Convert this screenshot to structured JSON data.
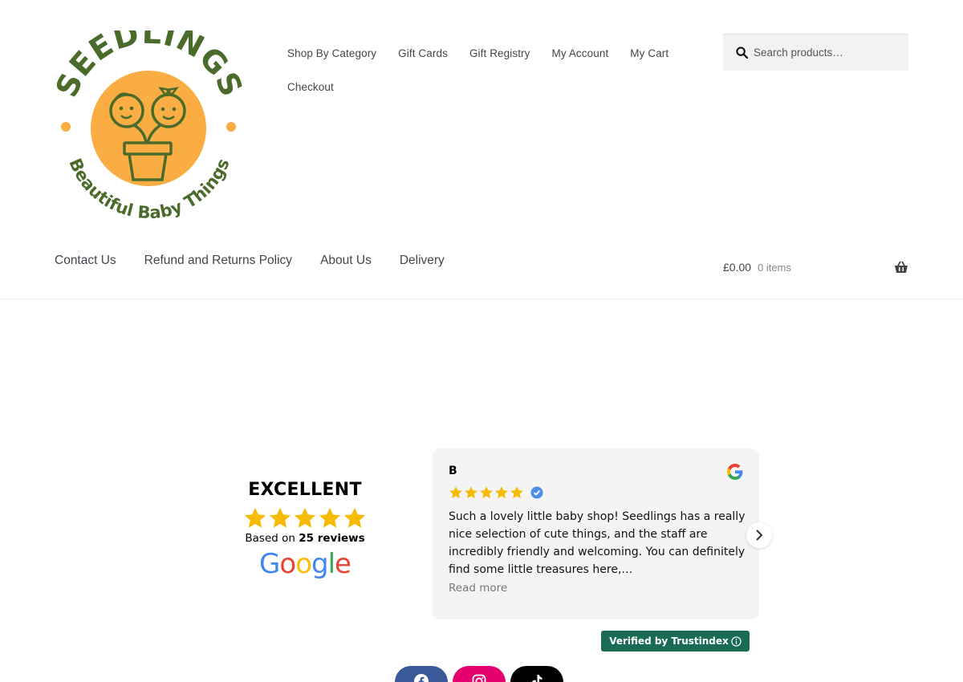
{
  "logo": {
    "brand": "SEEDLINGS",
    "tagline": "Beautiful Baby Things",
    "colors": {
      "green": "#4a6b2a",
      "orange": "#f9ad42"
    }
  },
  "primary_nav": {
    "items": [
      "Shop By Category",
      "Gift Cards",
      "Gift Registry",
      "My Account",
      "My Cart",
      "Checkout"
    ]
  },
  "search": {
    "placeholder": "Search products…",
    "icon": "search-icon"
  },
  "secondary_nav": {
    "items": [
      "Contact Us",
      "Refund and Returns Policy",
      "About Us",
      "Delivery"
    ]
  },
  "cart": {
    "amount": "£0.00",
    "count": "0 items",
    "icon": "basket-icon"
  },
  "reviews": {
    "summary": {
      "title": "EXCELLENT",
      "stars": 5,
      "based_on_prefix": "Based on ",
      "based_on_count": "25 reviews",
      "source": "Google"
    },
    "card": {
      "reviewer": "B",
      "stars": 5,
      "text": "Such a lovely little baby shop! Seedlings has a really nice selection of cute things, and the staff are incredibly friendly and welcoming. You can definitely find some little treasures here,…",
      "read_more": "Read more"
    },
    "verified_badge": "Verified by Trustindex",
    "star_color": "#f6bb06",
    "badge_color": "#1a6b53"
  },
  "social": {
    "items": [
      {
        "name": "facebook-icon",
        "color": "#3b5998"
      },
      {
        "name": "instagram-icon",
        "color": "#e4006f"
      },
      {
        "name": "tiktok-icon",
        "color": "#000000"
      }
    ]
  }
}
